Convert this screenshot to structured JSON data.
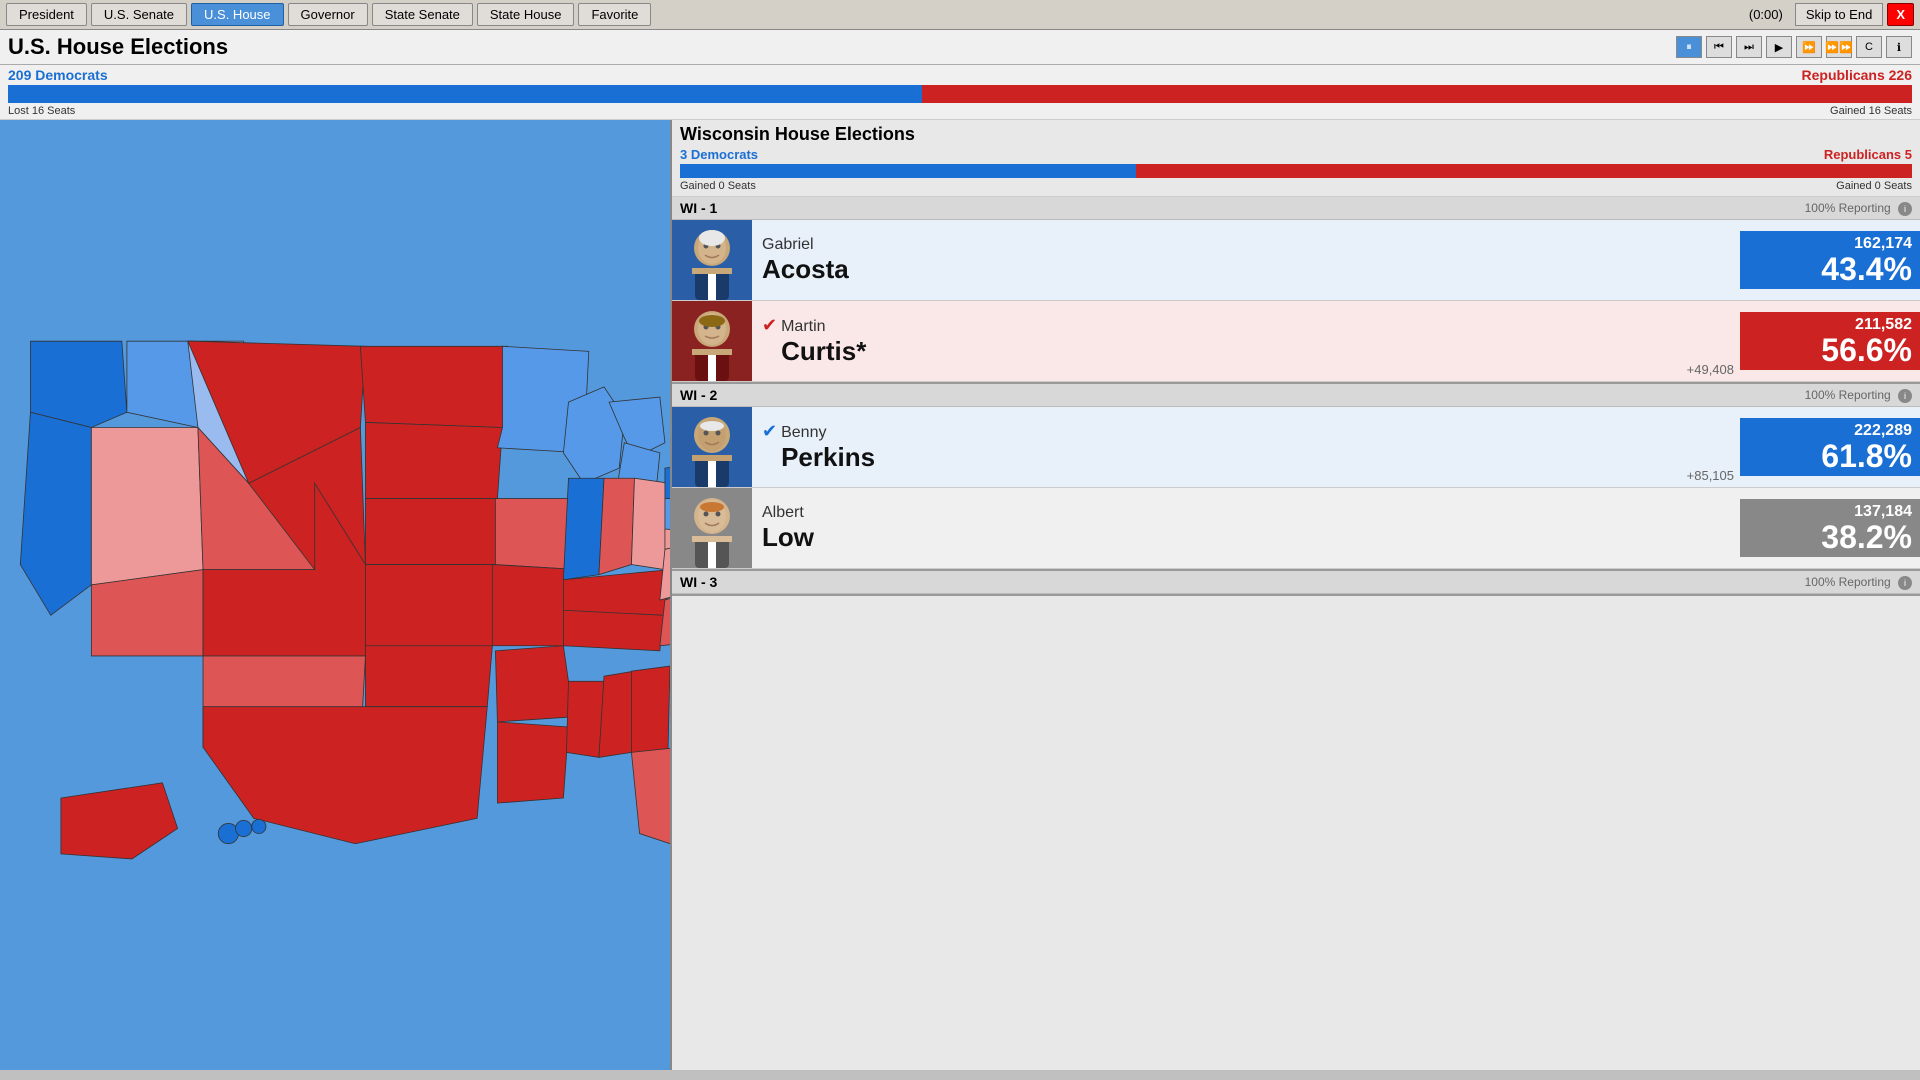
{
  "nav": {
    "items": [
      "President",
      "U.S. Senate",
      "U.S. House",
      "Governor",
      "State Senate",
      "State House",
      "Favorite"
    ],
    "active": "U.S. House",
    "timer": "(0:00)",
    "skip_label": "Skip to End",
    "close_label": "X"
  },
  "header": {
    "title": "U.S. House Elections",
    "controls": [
      "⏸",
      "⏭",
      "⏭",
      "▶",
      "⏩",
      "⏩⏩",
      "C",
      "ℹ"
    ]
  },
  "national": {
    "dem_label": "209 Democrats",
    "rep_label": "Republicans 226",
    "dem_pct": 48,
    "rep_pct": 52,
    "lost_seats": "Lost 16 Seats",
    "gained_seats": "Gained 16 Seats"
  },
  "wisconsin": {
    "title": "Wisconsin House Elections",
    "dem_label": "3 Democrats",
    "rep_label": "Republicans 5",
    "dem_pct": 37,
    "rep_pct": 63,
    "dem_seats_change": "Gained 0 Seats",
    "rep_seats_change": "Gained 0 Seats"
  },
  "districts": [
    {
      "id": "WI - 1",
      "reporting": "100% Reporting",
      "candidates": [
        {
          "first": "Gabriel",
          "last": "Acosta",
          "party": "dem",
          "votes": "162,174",
          "pct": "43.4%",
          "winner": false,
          "margin": ""
        },
        {
          "first": "Martin",
          "last": "Curtis*",
          "party": "rep",
          "votes": "211,582",
          "pct": "56.6%",
          "winner": true,
          "margin": "+49,408"
        }
      ]
    },
    {
      "id": "WI - 2",
      "reporting": "100% Reporting",
      "candidates": [
        {
          "first": "Benny",
          "last": "Perkins",
          "party": "dem",
          "votes": "222,289",
          "pct": "61.8%",
          "winner": true,
          "margin": "+85,105"
        },
        {
          "first": "Albert",
          "last": "Low",
          "party": "ind",
          "votes": "137,184",
          "pct": "38.2%",
          "winner": false,
          "margin": ""
        }
      ]
    },
    {
      "id": "WI - 3",
      "reporting": "100% Reporting",
      "candidates": []
    }
  ]
}
